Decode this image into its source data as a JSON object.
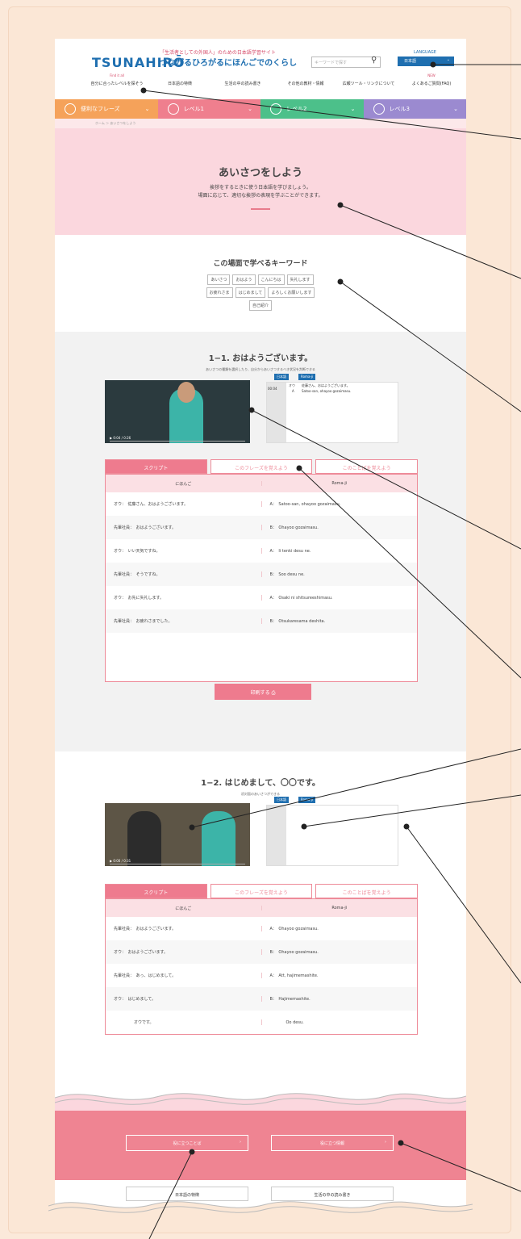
{
  "header": {
    "logo": "TSUNAHIRŌ",
    "tagline": "「生活者としての外国人」のための日本語学習サイト",
    "site_name": "つながるひろがるにほんごでのくらし",
    "search_placeholder": "キーワードで探す",
    "language_label": "LANGUAGE",
    "language_value": "日本語"
  },
  "nav": [
    {
      "sub": "Find it all",
      "label": "自分に合ったレベルを探そう"
    },
    {
      "sub": "",
      "label": "日本語の特徴"
    },
    {
      "sub": "",
      "label": "生活の中の読み書き"
    },
    {
      "sub": "",
      "label": "その他の教材・情報"
    },
    {
      "sub": "",
      "label": "広報ツール・リンクについて"
    },
    {
      "sub": "NEW",
      "label": "よくあるご質問(FAQ)"
    }
  ],
  "levels": [
    {
      "label": "便利なフレーズ",
      "color": "#f5a25a"
    },
    {
      "label": "レベル1",
      "color": "#ef7f8e"
    },
    {
      "label": "レベル2",
      "color": "#4cc08a"
    },
    {
      "label": "レベル3",
      "color": "#9b8ad0"
    }
  ],
  "breadcrumb": "ホーム ＞ あいさつをしよう",
  "hero": {
    "title": "あいさつをしよう",
    "line1": "挨拶をするときに使う日本語を学びましょう。",
    "line2": "場面に応じて、適切な挨拶の表現を学ぶことができます。"
  },
  "keywords": {
    "title": "この場面で学べるキーワード",
    "tags": [
      "あいさつ",
      "おはよう",
      "こんにちは",
      "失礼します",
      "お疲れさま",
      "はじめまして",
      "よろしくお願いします",
      "自己紹介"
    ]
  },
  "lesson1": {
    "title": "1−1. おはようございます。",
    "desc": "あいさつの種類を選択したり、自分からあいさつするべき状況を判断できる",
    "video_time": "▶ 0:04 / 0:26",
    "sub_buttons": [
      "日本語",
      "Roma-ji"
    ],
    "subtitle_time": "00:04",
    "subtitle_speaker": "オウ",
    "subtitle_jp": "佐藤さん、おはようございます。",
    "subtitle_romaji_speaker": "A",
    "subtitle_romaji": "Satoo-san, ohayoo gozaimasu.",
    "tabs": [
      "スクリプト",
      "このフレーズを覚えよう",
      "このことばを覚えよう"
    ],
    "headers": [
      "にほんご",
      "Roma-ji"
    ],
    "rows": [
      [
        "オウ：　佐藤さん、おはようございます。",
        "A：　Satoo-san, ohayoo gozaimasu."
      ],
      [
        "先輩社員：　おはようございます。",
        "B：　Ohayoo gozaimasu."
      ],
      [
        "オウ：　いい天気ですね。",
        "A：　Ii tenki desu ne."
      ],
      [
        "先輩社員：　そうですね。",
        "B：　Soo desu ne."
      ],
      [
        "オウ：　お先に失礼します。",
        "A：　Osaki ni shitsureeshimasu."
      ],
      [
        "先輩社員：　お疲れさまでした。",
        "B：　Otsukaresama deshita."
      ]
    ],
    "print": "印刷する"
  },
  "lesson2": {
    "title": "1−2. はじめまして、〇〇です。",
    "desc": "初対面のあいさつができる",
    "video_time": "▶ 0:00 / 0:31",
    "tabs": [
      "スクリプト",
      "このフレーズを覚えよう",
      "このことばを覚えよう"
    ],
    "headers": [
      "にほんご",
      "Roma-ji"
    ],
    "rows": [
      [
        "先輩社員：　おはようございます。",
        "A：　Ohayoo gozaimasu."
      ],
      [
        "オウ：　おはようございます。",
        "B：　Ohayoo gozaimasu."
      ],
      [
        "先輩社員：　あっ、はじめまして。",
        "A：　Att, hajimemashite."
      ],
      [
        "オウ：　はじめまして。",
        "B：　Hajimemashite."
      ],
      [
        "　　　　　オウです。",
        "　　　　Oo desu."
      ]
    ]
  },
  "footer": {
    "btn1": "役に立つことば",
    "btn2": "役に立つ情報",
    "link1": "日本語の特徴",
    "link2": "生活の中の読み書き"
  }
}
